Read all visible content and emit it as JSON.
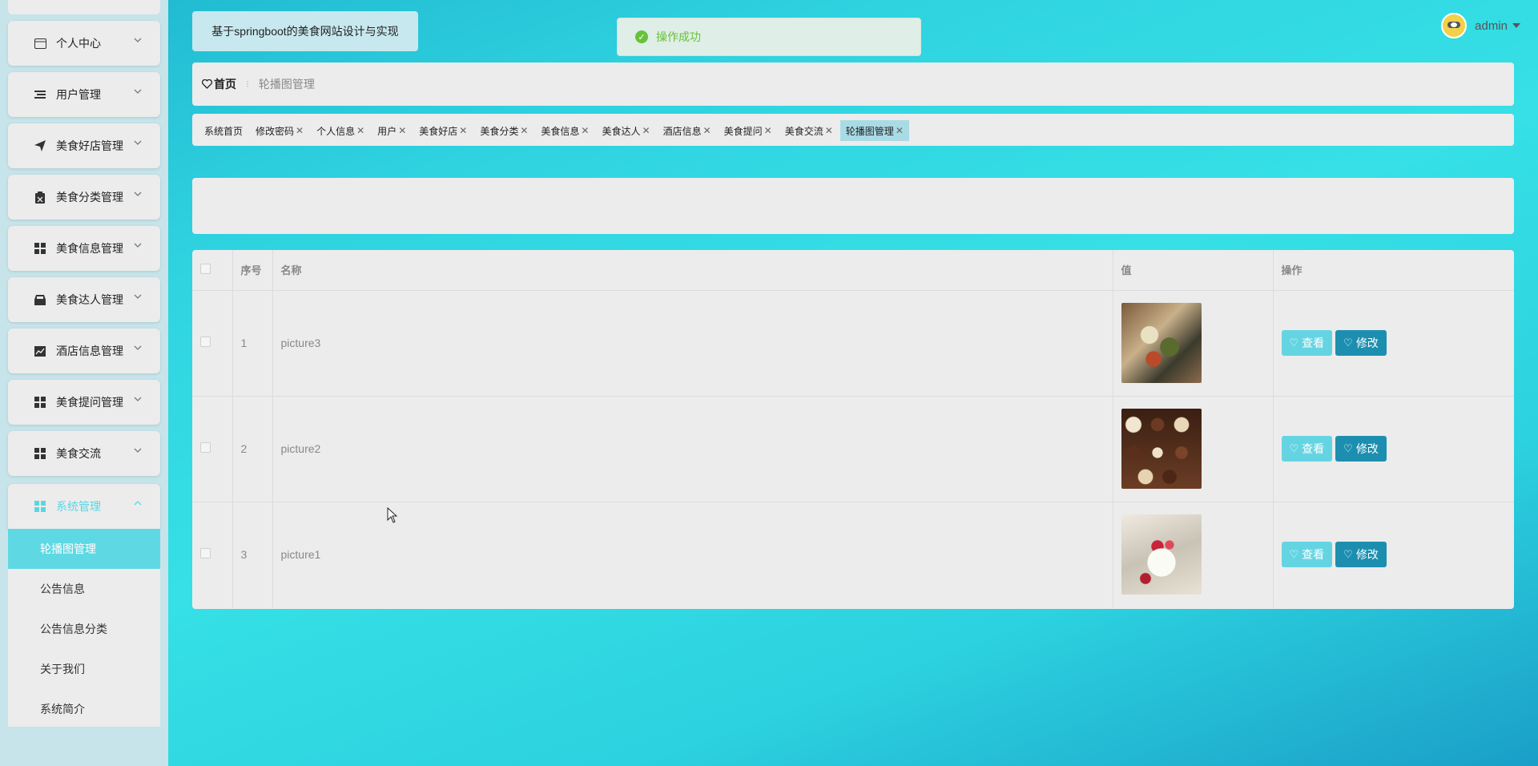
{
  "app": {
    "title": "基于springboot的美食网站设计与实现"
  },
  "toast": {
    "message": "操作成功",
    "status_color": "#67c23a"
  },
  "user": {
    "name": "admin"
  },
  "sidebar": {
    "items": [
      {
        "label": "个人中心",
        "icon": "card-icon"
      },
      {
        "label": "用户管理",
        "icon": "list-icon"
      },
      {
        "label": "美食好店管理",
        "icon": "send-icon"
      },
      {
        "label": "美食分类管理",
        "icon": "clipboard-icon"
      },
      {
        "label": "美食信息管理",
        "icon": "grid-icon"
      },
      {
        "label": "美食达人管理",
        "icon": "inbox-icon"
      },
      {
        "label": "酒店信息管理",
        "icon": "chart-icon"
      },
      {
        "label": "美食提问管理",
        "icon": "grid-icon"
      },
      {
        "label": "美食交流",
        "icon": "grid-icon"
      },
      {
        "label": "系统管理",
        "icon": "grid-icon",
        "expanded": true
      }
    ],
    "submenu": [
      {
        "label": "轮播图管理",
        "active": true
      },
      {
        "label": "公告信息"
      },
      {
        "label": "公告信息分类"
      },
      {
        "label": "关于我们"
      },
      {
        "label": "系统简介"
      }
    ]
  },
  "breadcrumb": {
    "home": "首页",
    "current": "轮播图管理"
  },
  "tabs": [
    {
      "label": "系统首页",
      "closable": false
    },
    {
      "label": "修改密码",
      "closable": true
    },
    {
      "label": "个人信息",
      "closable": true
    },
    {
      "label": "用户",
      "closable": true
    },
    {
      "label": "美食好店",
      "closable": true
    },
    {
      "label": "美食分类",
      "closable": true
    },
    {
      "label": "美食信息",
      "closable": true
    },
    {
      "label": "美食达人",
      "closable": true
    },
    {
      "label": "酒店信息",
      "closable": true
    },
    {
      "label": "美食提问",
      "closable": true
    },
    {
      "label": "美食交流",
      "closable": true
    },
    {
      "label": "轮播图管理",
      "closable": true,
      "active": true
    }
  ],
  "table": {
    "columns": [
      "序号",
      "名称",
      "值",
      "操作"
    ],
    "rows": [
      {
        "index": "1",
        "name": "picture3",
        "image": "food-platter-image"
      },
      {
        "index": "2",
        "name": "picture2",
        "image": "chocolates-image"
      },
      {
        "index": "3",
        "name": "picture1",
        "image": "dessert-image"
      }
    ],
    "actions": {
      "view": "查看",
      "edit": "修改"
    }
  },
  "colors": {
    "accent": "#5ed9e3",
    "edit_button": "#1c8fb0",
    "view_button": "#65d4e2"
  }
}
